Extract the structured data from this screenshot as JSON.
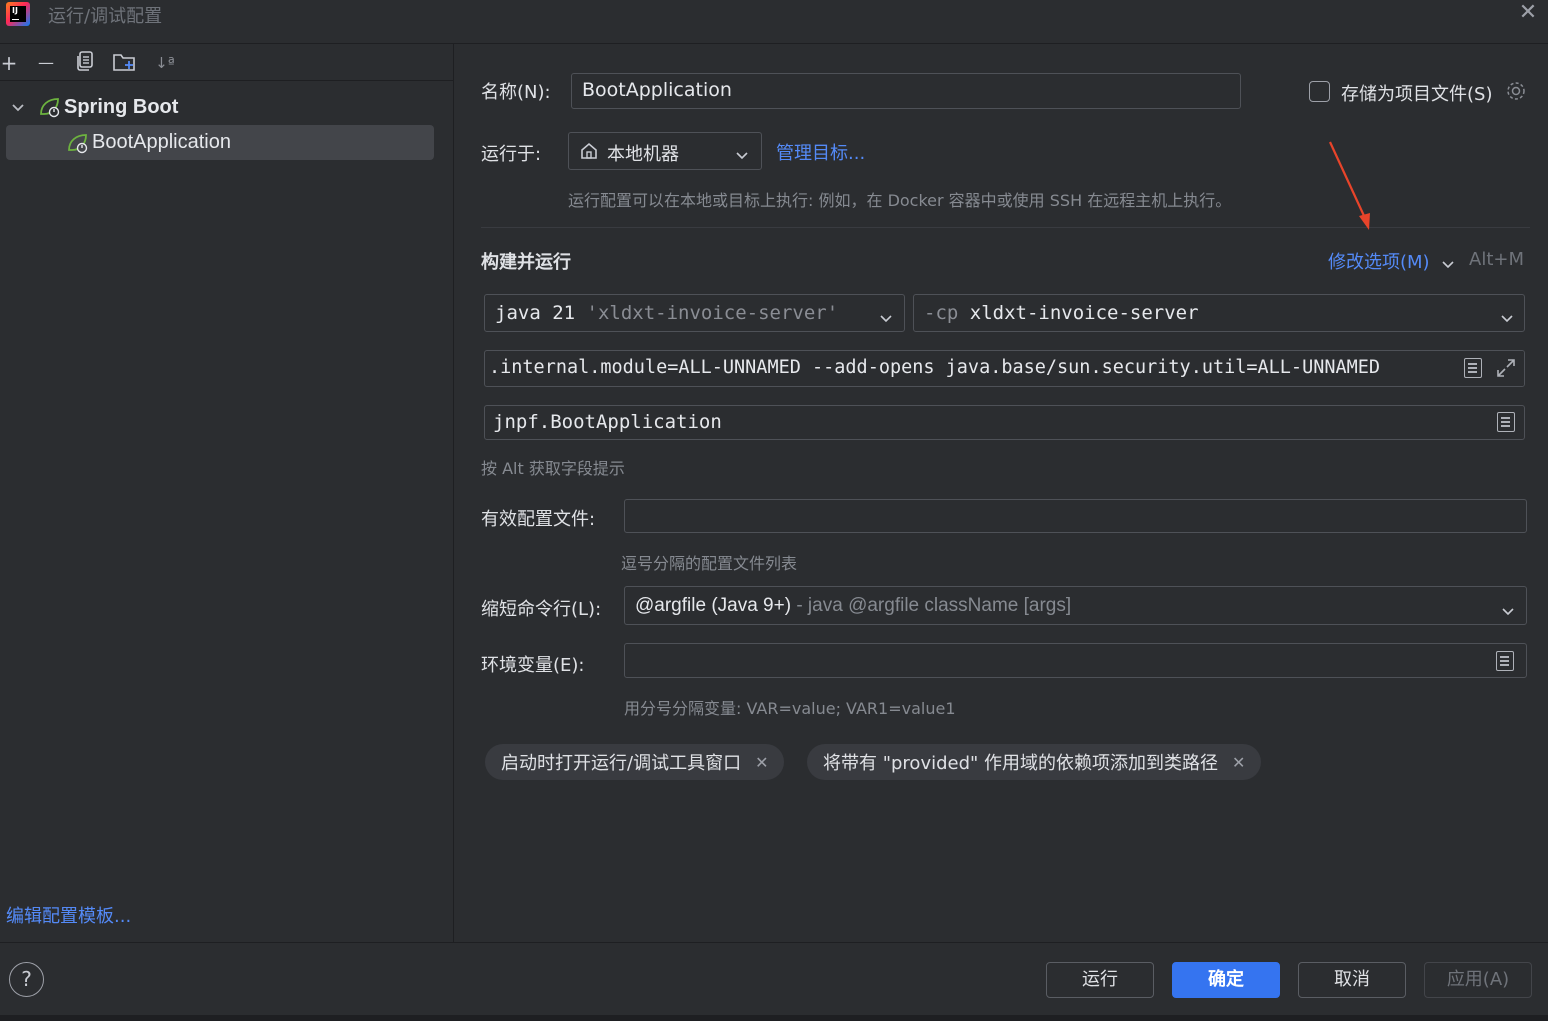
{
  "window": {
    "title": "运行/调试配置",
    "close_glyph": "✕"
  },
  "toolbar": {
    "add": "+",
    "remove": "—",
    "sort": "↓ª"
  },
  "tree": {
    "group_label": "Spring Boot",
    "item_label": "BootApplication",
    "chevron": "⌄"
  },
  "sidebar": {
    "edit_templates_link": "编辑配置模板..."
  },
  "form": {
    "name_label": "名称(N):",
    "name_value": "BootApplication",
    "store_as_project_file_label": "存储为项目文件(S)",
    "run_on_label": "运行于:",
    "run_on_value": "本地机器",
    "manage_targets_link": "管理目标...",
    "run_on_hint": "运行配置可以在本地或目标上执行: 例如，在 Docker 容器中或使用 SSH 在远程主机上执行。",
    "build_and_run_heading": "构建并运行",
    "modify_options_link": "修改选项(M)",
    "modify_options_shortcut": "Alt+M",
    "jdk_prefix": "java 21",
    "jdk_module": "'xldxt-invoice-server'",
    "cp_prefix": "-cp",
    "cp_value": "xldxt-invoice-server",
    "vm_options_value": ".internal.module=ALL-UNNAMED --add-opens java.base/sun.security.util=ALL-UNNAMED",
    "main_class_value": "jnpf.BootApplication",
    "alt_hint": "按 Alt 获取字段提示",
    "active_profiles_label": "有效配置文件:",
    "active_profiles_value": "",
    "active_profiles_hint": "逗号分隔的配置文件列表",
    "shorten_cmdline_label": "缩短命令行(L):",
    "shorten_cmdline_value": "@argfile (Java 9+)",
    "shorten_cmdline_detail": "- java @argfile className [args]",
    "env_vars_label": "环境变量(E):",
    "env_vars_value": "",
    "env_vars_hint": "用分号分隔变量: VAR=value; VAR1=value1"
  },
  "chips": [
    {
      "label": "启动时打开运行/调试工具窗口"
    },
    {
      "label": "将带有 \"provided\" 作用域的依赖项添加到类路径"
    }
  ],
  "chip_close_glyph": "✕",
  "buttons": {
    "help": "?",
    "run": "运行",
    "ok": "确定",
    "cancel": "取消",
    "apply": "应用(A)"
  },
  "colors": {
    "background": "#2b2d30",
    "accent": "#3574f0",
    "link": "#548af7",
    "annotation_arrow": "#e8442a",
    "spring_green": "#6db33f"
  }
}
